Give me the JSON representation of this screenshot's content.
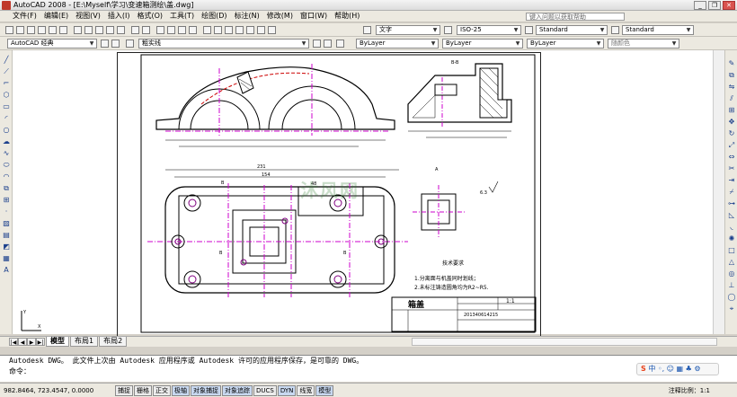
{
  "app": {
    "title": "AutoCAD 2008 - [E:\\Myself\\学习\\变速箱测绘\\盖.dwg]",
    "help_placeholder": "键入问题以获取帮助"
  },
  "menu": [
    "文件(F)",
    "编辑(E)",
    "视图(V)",
    "插入(I)",
    "格式(O)",
    "工具(T)",
    "绘图(D)",
    "标注(N)",
    "修改(M)",
    "窗口(W)",
    "帮助(H)"
  ],
  "toolbar2": {
    "text_style_label": "文字",
    "dim_style": "ISO-25",
    "table_style": "Standard",
    "mleader_style": "Standard"
  },
  "toolbar3": {
    "workspace": "AutoCAD 经典",
    "layer": "粗实线",
    "color": "ByLayer",
    "linetype": "ByLayer",
    "lineweight": "ByLayer",
    "plotstyle": "随颜色"
  },
  "tabs": [
    "模型",
    "布局1",
    "布局2"
  ],
  "command": {
    "line1": "Autodesk DWG。  此文件上次由 Autodesk 应用程序或 Autodesk 许可的应用程序保存，是可靠的 DWG。",
    "prompt": "命令："
  },
  "status": {
    "coords": "982.8464, 723.4547, 0.0000",
    "toggles": [
      "捕捉",
      "栅格",
      "正交",
      "极轴",
      "对象捕捉",
      "对象追踪",
      "DUCS",
      "DYN",
      "线宽",
      "模型"
    ],
    "annotation_scale": "注释比例：1:1"
  },
  "drawing": {
    "section_label": "B-B",
    "view_a_label": "A",
    "tech_req_title": "技术要求",
    "tech_req_1": "1.分离面与机盖同时划线；",
    "tech_req_2": "2.未标注铸造圆角均为R2~R5.",
    "title_name": "箱盖",
    "title_scale": "1:1",
    "title_drawing_no": "201340614215",
    "dim_overall": "231",
    "dim_inner": "154",
    "dim_section": "48",
    "label_b": "B",
    "roughness": "6.3"
  },
  "ime": {
    "brand": "S",
    "text": "中 ◦, ☺ ▦ ♣ ⚙"
  }
}
